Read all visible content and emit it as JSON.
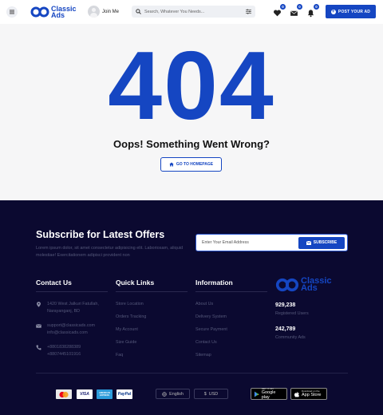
{
  "header": {
    "logo_line1": "Classic",
    "logo_line2": "Ads",
    "join_label": "Join Me",
    "search_placeholder": "Search, Whatever You Needs...",
    "badges": {
      "favorites": "0",
      "messages": "0",
      "notifications": "0"
    },
    "post_ad_label": "POST YOUR AD"
  },
  "error": {
    "code": "404",
    "message": "Oops! Something Went Wrong?",
    "home_button": "GO TO HOMEPAGE"
  },
  "subscribe": {
    "title": "Subscribe for Latest Offers",
    "description": "Lorem ipsum dolor, sit amet consectetur adipisicing elit. Laboriosam, aliquid molestiae! Exercitationem adipisci provident non",
    "placeholder": "Enter Your Email Address",
    "button": "SUBSCRIBE"
  },
  "contact": {
    "title": "Contact Us",
    "address_line1": "1420 West Jalkuri Fatullah,",
    "address_line2": "Narayanganj, BD",
    "email1": "support@classicads.com",
    "email2": "info@classicads.com",
    "phone1": "+8801838288389",
    "phone2": "+8807445101916"
  },
  "quick_links": {
    "title": "Quick Links",
    "items": [
      "Store Location",
      "Orders Tracking",
      "My Account",
      "Size Guide",
      "Faq"
    ]
  },
  "information": {
    "title": "Information",
    "items": [
      "About Us",
      "Delivery System",
      "Secure Payment",
      "Contact Us",
      "Sitemap"
    ]
  },
  "brand": {
    "line1": "Classic",
    "line2": "Ads",
    "registered_count": "929,238",
    "registered_label": "Registered Users",
    "community_count": "242,789",
    "community_label": "Community Ads"
  },
  "bottom": {
    "payments": [
      "mastercard",
      "VISA",
      "AMERICAN EXPRESS",
      "PayPal"
    ],
    "language": "English",
    "currency": "USD",
    "google_play_small": "GET IT ON",
    "google_play_big": "Google play",
    "app_store_small": "Download on the",
    "app_store_big": "App Store"
  },
  "colors": {
    "accent": "#1546c2",
    "footer_bg": "#0b0930",
    "page_bg": "#f6f6f7"
  }
}
